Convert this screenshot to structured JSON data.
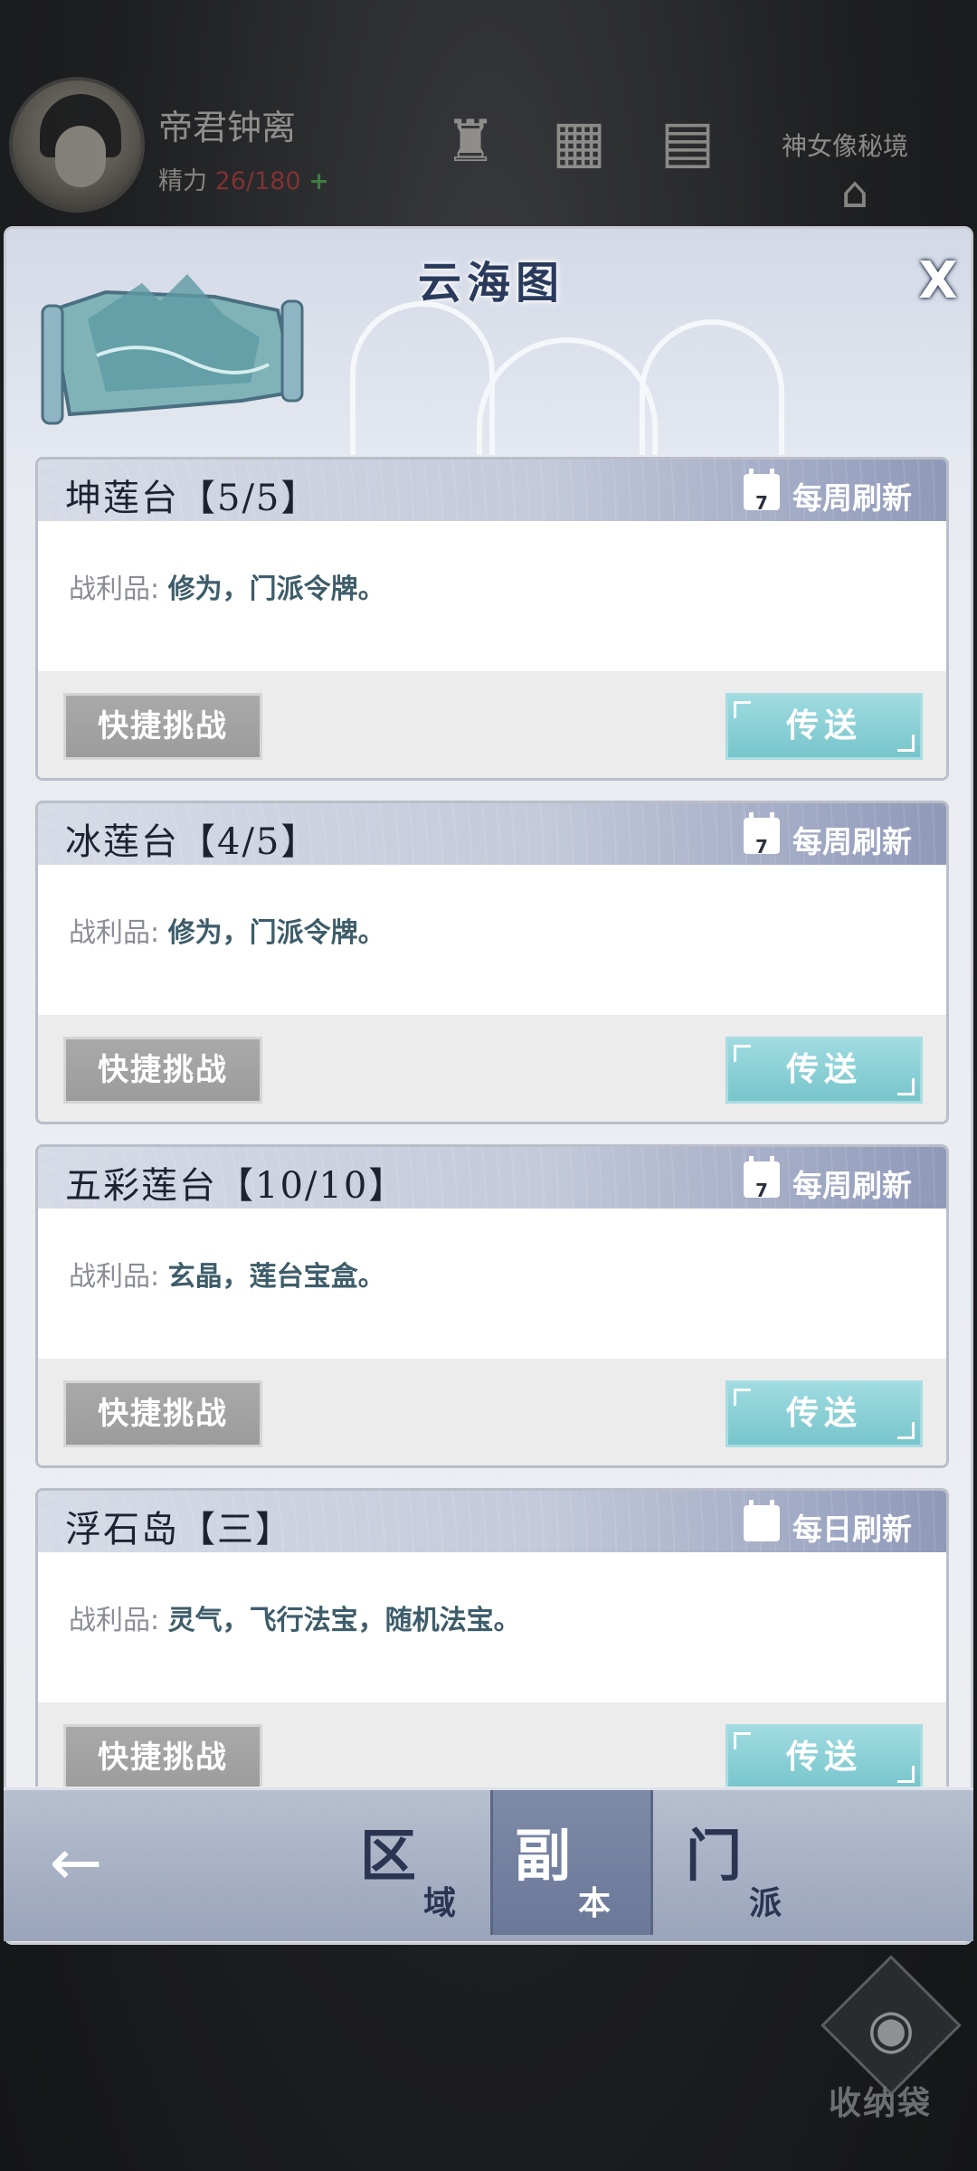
{
  "hud": {
    "player_name": "帝君钟离",
    "energy_label": "精力",
    "energy_value": "26/180",
    "energy_plus": "+",
    "realm_label": "神女像秘境"
  },
  "panel": {
    "title": "云海图",
    "close_label": "X"
  },
  "dungeons": [
    {
      "title": "坤莲台【5/5】",
      "calendar_day": "7",
      "refresh": "每周刷新",
      "loot_label": "战利品:",
      "loot": "修为，门派令牌。",
      "quick_label": "快捷挑战",
      "teleport_label": "传送"
    },
    {
      "title": "冰莲台【4/5】",
      "calendar_day": "7",
      "refresh": "每周刷新",
      "loot_label": "战利品:",
      "loot": "修为，门派令牌。",
      "quick_label": "快捷挑战",
      "teleport_label": "传送"
    },
    {
      "title": "五彩莲台【10/10】",
      "calendar_day": "7",
      "refresh": "每周刷新",
      "loot_label": "战利品:",
      "loot": "玄晶，莲台宝盒。",
      "quick_label": "快捷挑战",
      "teleport_label": "传送"
    },
    {
      "title": "浮石岛【三】",
      "calendar_day": "",
      "refresh": "每日刷新",
      "loot_label": "战利品:",
      "loot": "灵气，飞行法宝，随机法宝。",
      "quick_label": "快捷挑战",
      "teleport_label": "传送"
    }
  ],
  "nav": {
    "back_icon": "←",
    "tabs": [
      {
        "big": "区",
        "small": "域"
      },
      {
        "big": "副",
        "small": "本"
      },
      {
        "big": "门",
        "small": "派"
      }
    ]
  },
  "bag": {
    "label": "收纳袋"
  },
  "colors": {
    "accent_teleport": "#77c5cc",
    "quick_button": "#9c9c9c",
    "title_text": "#2a3a5c",
    "energy_value": "#c63b3b"
  }
}
